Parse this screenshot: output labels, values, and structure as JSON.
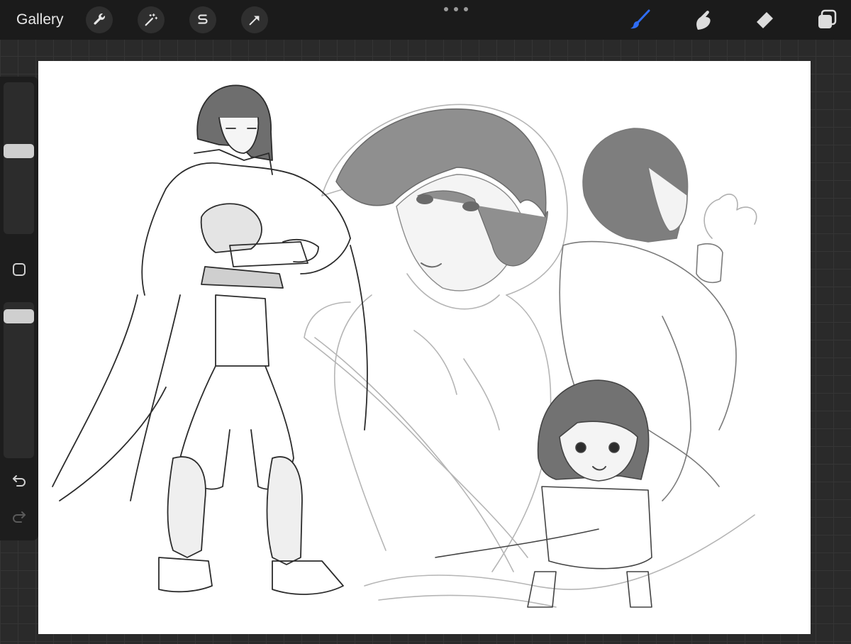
{
  "toolbar": {
    "gallery_label": "Gallery",
    "left_tools": [
      {
        "name": "actions",
        "icon": "wrench-icon"
      },
      {
        "name": "adjustments",
        "icon": "magic-wand-icon"
      },
      {
        "name": "selection",
        "icon": "selection-s-icon"
      },
      {
        "name": "transform",
        "icon": "arrow-cursor-icon"
      }
    ],
    "right_tools": [
      {
        "name": "brush",
        "icon": "brush-icon",
        "active": true
      },
      {
        "name": "smudge",
        "icon": "smudge-finger-icon",
        "active": false
      },
      {
        "name": "eraser",
        "icon": "eraser-icon",
        "active": false
      },
      {
        "name": "layers",
        "icon": "layers-icon",
        "active": false
      }
    ],
    "more_icon": "more-dots-icon"
  },
  "sidebar": {
    "brush_size_level": 0.55,
    "opacity_level": 0.95,
    "modify_icon": "square-icon",
    "undo_icon": "undo-icon",
    "redo_icon": "redo-icon"
  },
  "colors": {
    "accent_active_tool": "#2f6df6",
    "toolbar_bg": "#1b1b1b",
    "canvas_bg": "#ffffff"
  }
}
